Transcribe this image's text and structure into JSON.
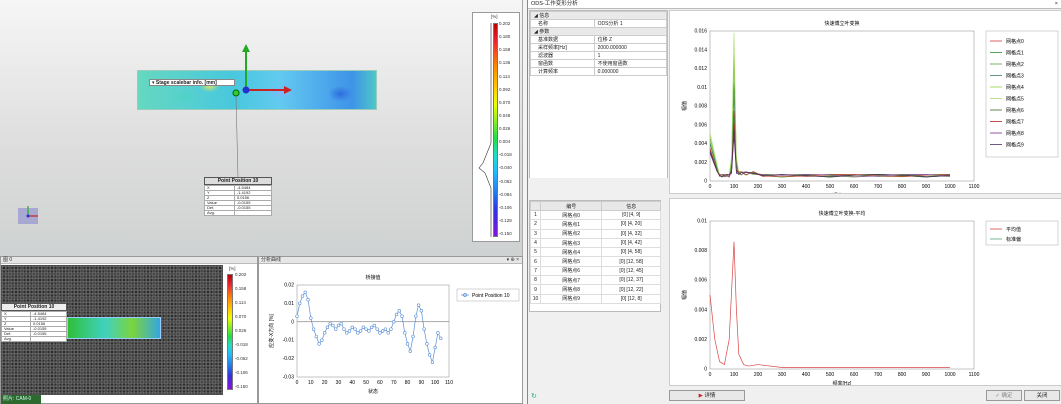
{
  "view3d": {
    "scalebar_label": "▾ Stage scalebar info. [mm]",
    "point_title": "Point Position 10",
    "point_rows": [
      [
        "X",
        "-4.5484"
      ],
      [
        "Y",
        "-1.4192"
      ],
      [
        "Z",
        "0.0156"
      ],
      [
        "Value",
        "-0.0155"
      ],
      [
        "Def.",
        "-0.0155"
      ],
      [
        "Avg.",
        ""
      ]
    ],
    "cbar_unit": "[%]",
    "cbar_ticks": [
      "0.202",
      "0.180",
      "0.158",
      "0.136",
      "0.114",
      "0.092",
      "0.070",
      "0.048",
      "0.026",
      "0.004",
      "-0.018",
      "-0.040",
      "-0.062",
      "-0.084",
      "-0.106",
      "-0.128",
      "-0.150"
    ]
  },
  "panel_image": {
    "title": "图 0",
    "footer": "照片: CAM-0",
    "point_title": "Point Position 10",
    "point_rows": [
      [
        "X",
        "-4.5484"
      ],
      [
        "Y",
        "-1.4192"
      ],
      [
        "Z",
        "0.0156"
      ],
      [
        "Value",
        "-0.0155"
      ],
      [
        "Def.",
        "-0.0155"
      ],
      [
        "Avg.",
        ""
      ]
    ],
    "cbar_unit": "[%]",
    "cbar_ticks": [
      "0.202",
      "0.158",
      "0.114",
      "0.070",
      "0.026",
      "-0.018",
      "-0.062",
      "-0.106",
      "-0.150"
    ]
  },
  "panel_curve": {
    "title": "分析曲线",
    "controls": "▾ ⊕ ×",
    "chart_data": {
      "type": "scatter",
      "title": "桥接值",
      "xlabel": "状态",
      "ylabel": "应变-X方向 [%]",
      "xlim": [
        0,
        110
      ],
      "ylim": [
        -0.03,
        0.02
      ],
      "xticks": [
        "0",
        "10",
        "20",
        "30",
        "40",
        "50",
        "60",
        "70",
        "80",
        "90",
        "100",
        "110"
      ],
      "yticks": [
        "0.02",
        "0.01",
        "0",
        "-0.01",
        "-0.02",
        "-0.03"
      ],
      "series": [
        {
          "name": "Point Position 10",
          "x": [
            0,
            2,
            4,
            6,
            8,
            10,
            12,
            14,
            16,
            18,
            20,
            22,
            24,
            26,
            28,
            30,
            32,
            34,
            36,
            38,
            40,
            42,
            44,
            46,
            48,
            50,
            52,
            54,
            56,
            58,
            60,
            62,
            64,
            66,
            68,
            70,
            72,
            74,
            76,
            78,
            80,
            82,
            84,
            86,
            88,
            90,
            92,
            94,
            96,
            98,
            100,
            102,
            104
          ],
          "y": [
            0.003,
            0.01,
            0.014,
            0.016,
            0.012,
            0.002,
            -0.004,
            -0.008,
            -0.012,
            -0.01,
            -0.006,
            -0.003,
            -0.001,
            -0.002,
            -0.004,
            -0.002,
            -0.001,
            -0.004,
            -0.006,
            -0.005,
            -0.003,
            -0.004,
            -0.006,
            -0.005,
            -0.003,
            -0.004,
            -0.005,
            -0.003,
            -0.002,
            -0.004,
            -0.006,
            -0.005,
            -0.004,
            -0.006,
            -0.004,
            0.0,
            0.004,
            0.006,
            0.003,
            -0.006,
            -0.012,
            -0.016,
            -0.008,
            0.003,
            0.009,
            0.006,
            -0.004,
            -0.012,
            -0.018,
            -0.022,
            -0.014,
            -0.006,
            -0.009
          ]
        }
      ]
    }
  },
  "window": {
    "title": "ODS-工作变形分析",
    "close": "×",
    "props": {
      "sections": [
        {
          "name": "信息",
          "rows": [
            [
              "名称",
              "ODS分析 1"
            ]
          ]
        },
        {
          "name": "参数",
          "rows": [
            [
              "基准数据",
              "位移 Z"
            ],
            [
              "采样频率[Hz]",
              "2000.000000"
            ],
            [
              "滤波器",
              "1"
            ],
            [
              "窗函数",
              "不使用窗函数"
            ],
            [
              "计算频率",
              "0.000000"
            ]
          ]
        }
      ]
    },
    "table": {
      "headers": [
        "",
        "编号",
        "信息"
      ],
      "rows": [
        [
          "1",
          "网格点0",
          "[0] [4, 9]"
        ],
        [
          "2",
          "网格点1",
          "[0] [4, 20]"
        ],
        [
          "3",
          "网格点2",
          "[0] [4, 32]"
        ],
        [
          "4",
          "网格点3",
          "[0] [4, 42]"
        ],
        [
          "5",
          "网格点4",
          "[0] [4, 58]"
        ],
        [
          "6",
          "网格点5",
          "[0] [12, 58]"
        ],
        [
          "7",
          "网格点6",
          "[0] [12, 45]"
        ],
        [
          "8",
          "网格点7",
          "[0] [12, 37]"
        ],
        [
          "9",
          "网格点8",
          "[0] [12, 22]"
        ],
        [
          "10",
          "网格点9",
          "[0] [12, 8]"
        ]
      ]
    },
    "fft_chart": {
      "chart_data": {
        "type": "line",
        "title": "快速傅立叶变换",
        "xlabel": "频率[Hz]",
        "ylabel": "幅值",
        "xlim": [
          0,
          1100
        ],
        "ylim": [
          0,
          0.016
        ],
        "xticks": [
          "0",
          "100",
          "200",
          "300",
          "400",
          "500",
          "600",
          "700",
          "800",
          "900",
          "1000",
          "1100"
        ],
        "yticks": [
          "0.016",
          "0.014",
          "0.012",
          "0.01",
          "0.008",
          "0.006",
          "0.004",
          "0.002",
          "0"
        ],
        "series": [
          {
            "name": "网格点0",
            "color": "#d93a3a",
            "peak": 0.0075
          },
          {
            "name": "网格点1",
            "color": "#2e8b2e",
            "peak": 0.0105
          },
          {
            "name": "网格点2",
            "color": "#5a9f3e",
            "peak": 0.0128
          },
          {
            "name": "网格点3",
            "color": "#3a7f5a",
            "peak": 0.0095
          },
          {
            "name": "网格点4",
            "color": "#8fcf3f",
            "peak": 0.0135
          },
          {
            "name": "网格点5",
            "color": "#a9d86f",
            "peak": 0.0158
          },
          {
            "name": "网格点6",
            "color": "#3d6b1e",
            "peak": 0.0068
          },
          {
            "name": "网格点7",
            "color": "#b22222",
            "peak": 0.0062
          },
          {
            "name": "网格点8",
            "color": "#7a2a8a",
            "peak": 0.0048
          },
          {
            "name": "网格点9",
            "color": "#4a2f5f",
            "peak": 0.0055
          }
        ]
      }
    },
    "avg_chart": {
      "chart_data": {
        "type": "line",
        "title": "快速傅立叶变换-平均",
        "xlabel": "频率[Hz]",
        "ylabel": "幅值",
        "xlim": [
          0,
          1100
        ],
        "ylim": [
          0,
          0.01
        ],
        "xticks": [
          "0",
          "100",
          "200",
          "300",
          "400",
          "500",
          "600",
          "700",
          "800",
          "900",
          "1000",
          "1100"
        ],
        "yticks": [
          "0.01",
          "0.008",
          "0.006",
          "0.004",
          "0.002",
          "0"
        ],
        "series": [
          {
            "name": "平均值",
            "color": "#d94545",
            "x": [
              0,
              20,
              40,
              60,
              80,
              100,
              110,
              120,
              140,
              160,
              200,
              300,
              1000
            ],
            "y": [
              0.005,
              0.002,
              0.0005,
              0.0003,
              0.002,
              0.0086,
              0.004,
              0.001,
              0.0003,
              0.0002,
              0.0003,
              0.0001,
              0.0001
            ]
          },
          {
            "name": "标准偏",
            "color": "#5aaa7a",
            "x": [],
            "y": []
          }
        ]
      }
    },
    "buttons": {
      "detail": "详情",
      "confirm": "✓ 确定",
      "close": "关闭"
    },
    "refresh_icon": "↻"
  }
}
